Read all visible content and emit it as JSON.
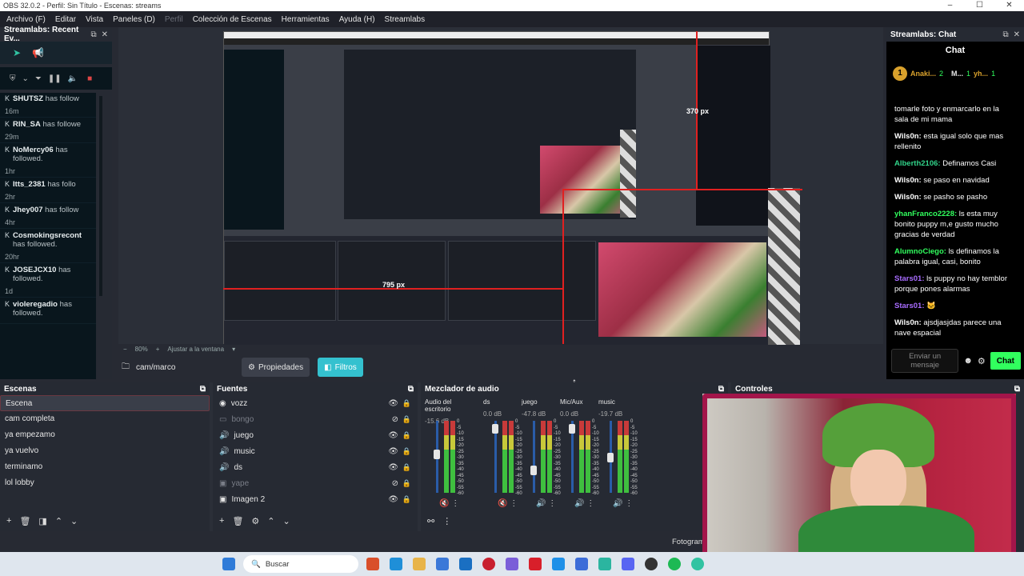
{
  "window": {
    "title": "OBS 32.0.2 - Perfil: Sin Título - Escenas: streams",
    "controls": [
      "–",
      "☐",
      "✕"
    ]
  },
  "menu": [
    {
      "label": "Archivo (F)",
      "dim": false
    },
    {
      "label": "Editar",
      "dim": false
    },
    {
      "label": "Vista",
      "dim": false
    },
    {
      "label": "Paneles (D)",
      "dim": false
    },
    {
      "label": "Perfil",
      "dim": true
    },
    {
      "label": "Colección de Escenas",
      "dim": false
    },
    {
      "label": "Herramientas",
      "dim": false
    },
    {
      "label": "Ayuda (H)",
      "dim": false
    },
    {
      "label": "Streamlabs",
      "dim": false
    }
  ],
  "left_dock": {
    "title": "Streamlabs: Recent Ev...",
    "events": [
      {
        "name": "SHUTSZ",
        "text": "has follow",
        "time": "16m"
      },
      {
        "name": "RIN_SA",
        "text": "has followe",
        "time": "29m"
      },
      {
        "name": "NoMercy06",
        "text": "has followed.",
        "time": "1hr"
      },
      {
        "name": "Itts_2381",
        "text": "has follo",
        "time": "2hr"
      },
      {
        "name": "Jhey007",
        "text": "has follow",
        "time": "4hr"
      },
      {
        "name": "Cosmokingsrecont",
        "text": "has followed.",
        "time": "20hr"
      },
      {
        "name": "JOSEJCX10",
        "text": "has followed.",
        "time": "1d"
      },
      {
        "name": "violeregadio",
        "text": "has followed.",
        "time": ""
      }
    ]
  },
  "preview": {
    "px_label_1": "370 px",
    "px_label_2": "795 px",
    "zoom": "80%",
    "fit": "Ajustar a la ventana"
  },
  "source_bar": {
    "selected": "cam/marco",
    "properties": "Propiedades",
    "filters": "Filtros"
  },
  "chat": {
    "dock_title": "Streamlabs: Chat",
    "title": "Chat",
    "top_user_1": "Anaki...",
    "top_user_1_amount": "2",
    "top_user_2": "M...",
    "top_user_2_amount": "1",
    "top_user_3": "yh...",
    "top_user_3_amount": "1",
    "messages": [
      {
        "user": "",
        "text": "tomarle foto y enmarcarlo en la sala de mi mama",
        "color": "#ffffff"
      },
      {
        "user": "Wils0n:",
        "text": "esta igual solo que mas rellenito",
        "color": "#ffffff"
      },
      {
        "user": "Alberth2106:",
        "text": "Definamos Casi",
        "color": "#31d48a"
      },
      {
        "user": "Wils0n:",
        "text": "se paso en navidad",
        "color": "#ffffff"
      },
      {
        "user": "Wils0n:",
        "text": "se pasho se pasho",
        "color": "#ffffff"
      },
      {
        "user": "yhanFranco2228:",
        "text": "ls esta muy bonito puppy m,e gusto mucho gracias de verdad",
        "color": "#31ff5e"
      },
      {
        "user": "AlumnoCiego:",
        "text": "ls definamos la palabra igual, casi, bonito",
        "color": "#31ff5e"
      },
      {
        "user": "Stars01:",
        "text": "ls puppy no hay temblor porque pones alarmas",
        "color": "#a86cff"
      },
      {
        "user": "Stars01:",
        "text": "🐱",
        "color": "#a86cff"
      },
      {
        "user": "Wils0n:",
        "text": "ajsdjasjdas parece una nave espacial",
        "color": "#ffffff"
      }
    ],
    "input_placeholder": "Enviar un mensaje",
    "send": "Chat"
  },
  "scenes": {
    "title": "Escenas",
    "items": [
      "Escena",
      "cam completa",
      "ya empezamo",
      "ya vuelvo",
      "terminamo",
      "lol lobby"
    ]
  },
  "sources": {
    "title": "Fuentes",
    "items": [
      {
        "label": "vozz",
        "icon": "audio-input-icon",
        "dim": false
      },
      {
        "label": "bongo",
        "icon": "window-capture-icon",
        "dim": true
      },
      {
        "label": "juego",
        "icon": "speaker-icon",
        "dim": false
      },
      {
        "label": "music",
        "icon": "speaker-icon",
        "dim": false
      },
      {
        "label": "ds",
        "icon": "speaker-icon",
        "dim": false
      },
      {
        "label": "yape",
        "icon": "image-icon",
        "dim": true
      },
      {
        "label": "Imagen 2",
        "icon": "image-icon",
        "dim": false
      }
    ]
  },
  "mixer": {
    "title": "Mezclador de audio",
    "channels": [
      {
        "name": "Audio del escritorio",
        "db": "-15.6 dB",
        "level": 0.55
      },
      {
        "name": "ds",
        "db": "0.0 dB",
        "level": 0.95
      },
      {
        "name": "juego",
        "db": "-47.8 dB",
        "level": 0.3
      },
      {
        "name": "Mic/Aux",
        "db": "0.0 dB",
        "level": 0.95
      },
      {
        "name": "music",
        "db": "-19.7 dB",
        "level": 0.5
      }
    ],
    "scale": [
      "0",
      "-5",
      "-10",
      "-15",
      "-20",
      "-25",
      "-30",
      "-35",
      "-40",
      "-45",
      "-50",
      "-55",
      "-60"
    ]
  },
  "controls": {
    "title": "Controles",
    "footer": "Fotogram"
  },
  "taskbar": {
    "search": "Buscar"
  },
  "colors": {
    "accent": "#34c1cf",
    "chat_send": "#31ff5e",
    "selection_border": "#6b3841"
  }
}
